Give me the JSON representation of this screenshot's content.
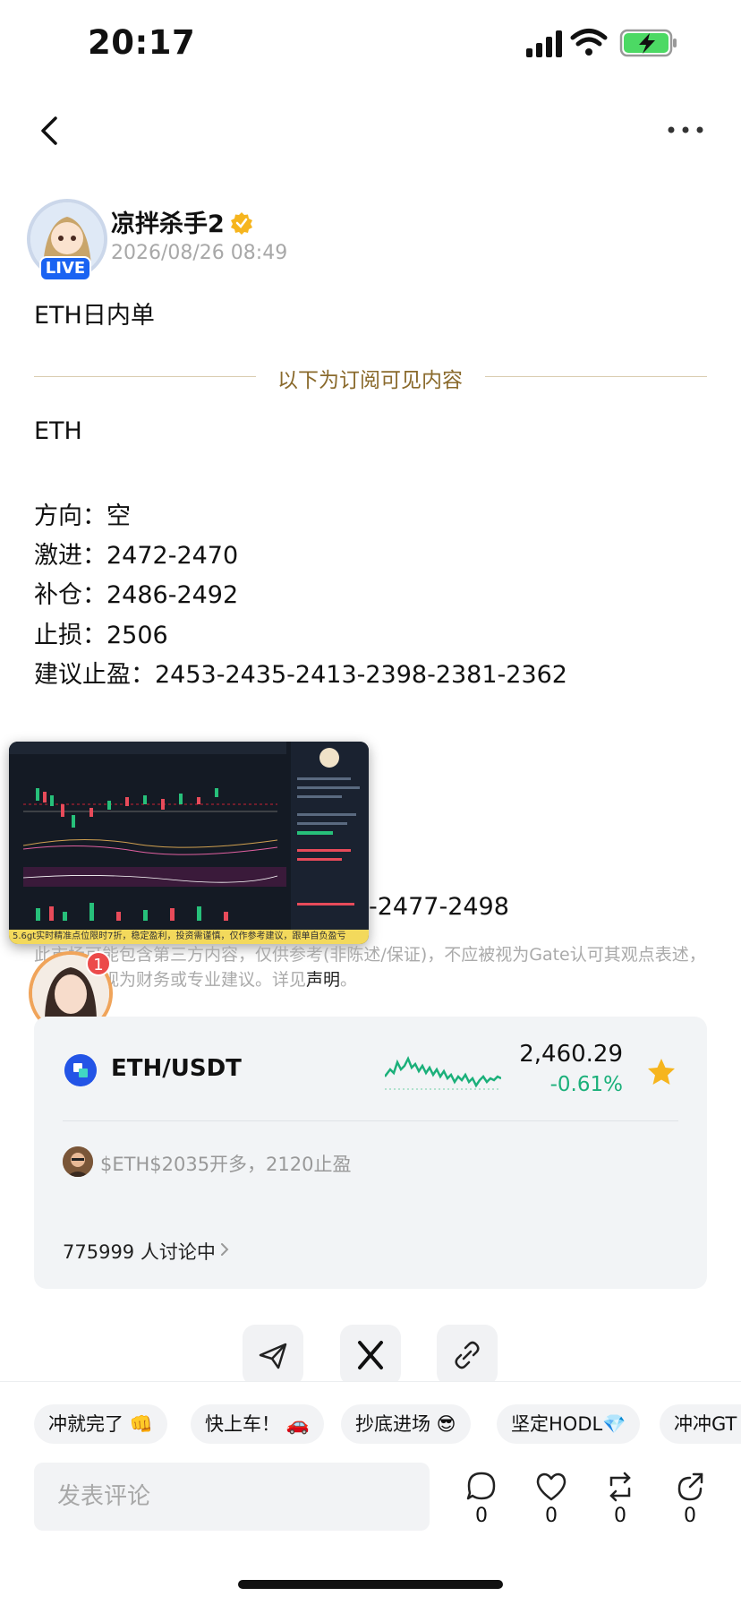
{
  "status_bar": {
    "time": "20:17"
  },
  "post": {
    "author": "凉拌杀手2",
    "live_badge": "LIVE",
    "date": "2026/08/26 08:49",
    "title": "ETH日内单",
    "divider_text": "以下为订阅可见内容",
    "body_lines": [
      "ETH",
      "方向：空",
      "激进：2472-2470",
      "补仓：2486-2492",
      "止损：2506",
      "建议止盈：2453-2435-2413-2398-2381-2362"
    ],
    "body_tail": "-2477-2498",
    "chart_banner": "5.6gt实时精准点位限时7折，稳定盈利，投资需谨慎，仅作参考建议，跟单自负盈亏",
    "disclaimer": "此市场可能包含第三方内容，仅供参考(非陈述/保证)，不应被视为Gate认可其观点表述，也不得被视为财务或专业建议。详见",
    "disclaimer_link": "声明",
    "disclaimer_end": "。",
    "streamer_badge": "1"
  },
  "market_card": {
    "pair": "ETH/USDT",
    "price": "2,460.29",
    "change": "-0.61%",
    "reply_text": "$ETH$2035开多，2120止盈",
    "discussion": "775999 人讨论中",
    "colors": {
      "up": "#1bb07a",
      "star": "#f6b51e",
      "icon": "#2354e6"
    }
  },
  "share_icons": [
    "send-icon",
    "x-logo-icon",
    "link-icon"
  ],
  "quick_chips": [
    "冲就完了 👊",
    "快上车！ 🚗",
    "抄底进场 😎",
    "坚定HODL💎",
    "冲冲GT"
  ],
  "comment": {
    "placeholder": "发表评论"
  },
  "actions": [
    {
      "name": "comment",
      "count": "0"
    },
    {
      "name": "like",
      "count": "0"
    },
    {
      "name": "repost",
      "count": "0"
    },
    {
      "name": "share",
      "count": "0"
    }
  ]
}
